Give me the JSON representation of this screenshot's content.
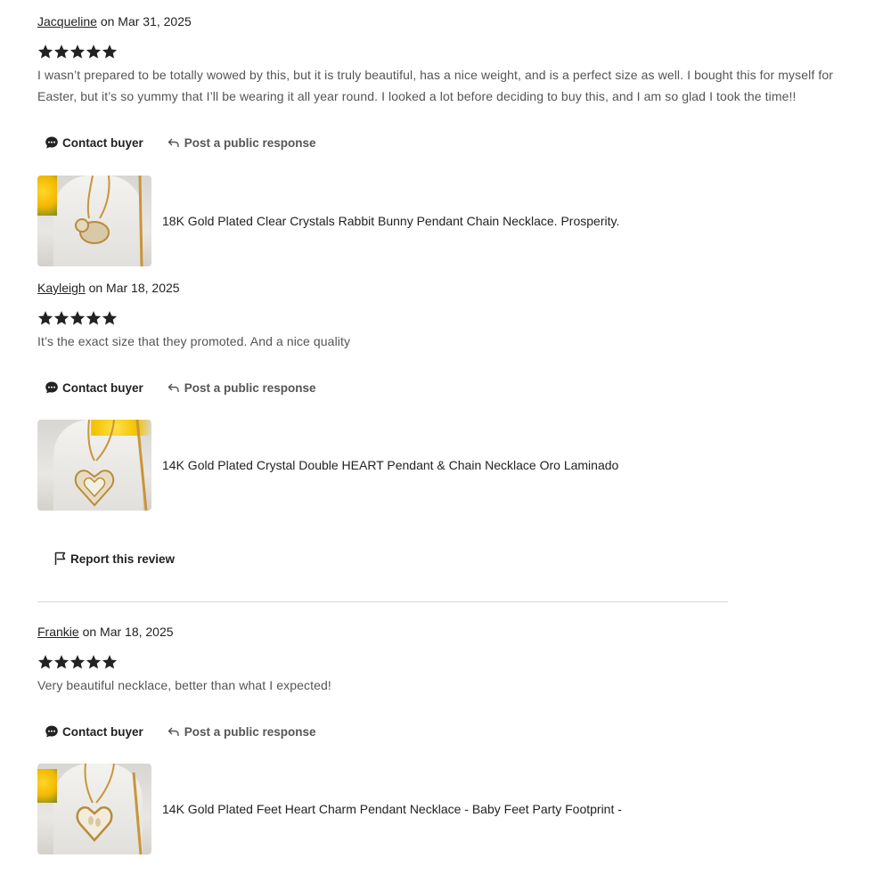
{
  "reviews": [
    {
      "author": "Jacqueline",
      "date_text": " on Mar 31, 2025",
      "rating": "5 stars",
      "text": "I wasn’t prepared to be totally wowed by this, but it is truly beautiful, has a nice weight, and is a perfect size as well. I bought this for myself for Easter, but it’s so yummy that I’ll be wearing it all year round. I looked a lot before deciding to buy this, and I am so glad I took the time!!",
      "contact_label": "Contact buyer",
      "respond_label": "Post a public response",
      "product_title": "18K Gold Plated Clear Crystals Rabbit Bunny Pendant Chain Necklace. Prosperity."
    },
    {
      "author": "Kayleigh",
      "date_text": " on Mar 18, 2025",
      "rating": "5 stars",
      "text": "It’s the exact size that they promoted. And a nice quality",
      "contact_label": "Contact buyer",
      "respond_label": "Post a public response",
      "product_title": "14K Gold Plated Crystal Double HEART Pendant & Chain Necklace Oro Laminado"
    },
    {
      "author": "Frankie",
      "date_text": " on Mar 18, 2025",
      "rating": "5 stars",
      "text": "Very beautiful necklace, better than what I expected!",
      "contact_label": "Contact buyer",
      "respond_label": "Post a public response",
      "product_title": "14K Gold Plated Feet Heart Charm Pendant Necklace - Baby Feet Party Footprint -"
    }
  ],
  "report_label": "Report this review",
  "colors": {
    "text": "#222222",
    "muted": "#555555",
    "divider": "#d6d6d6",
    "star": "#222222"
  }
}
